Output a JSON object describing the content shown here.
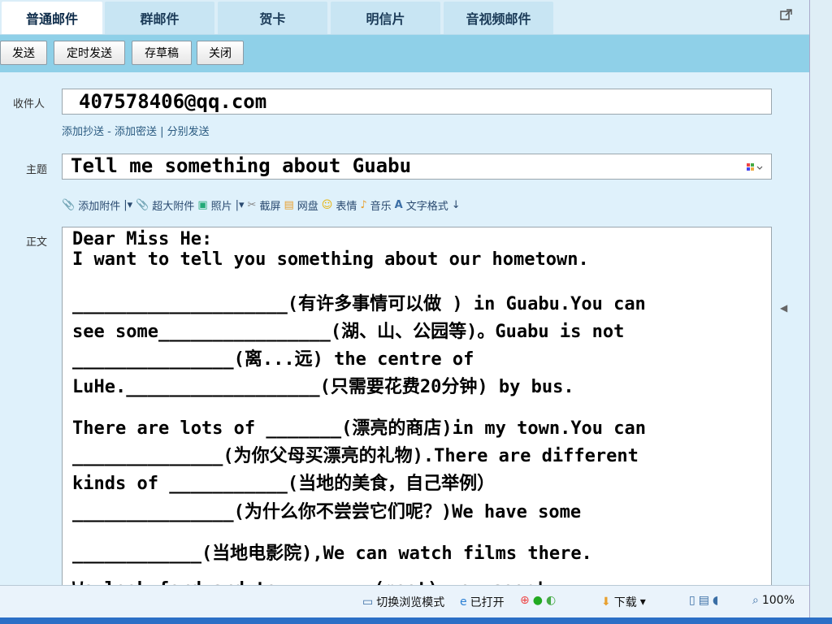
{
  "tabs": [
    {
      "label": "普通邮件",
      "active": true
    },
    {
      "label": "群邮件",
      "active": false
    },
    {
      "label": "贺卡",
      "active": false
    },
    {
      "label": "明信片",
      "active": false
    },
    {
      "label": "音视频邮件",
      "active": false
    }
  ],
  "toolbar": {
    "send": "发送",
    "scheduled_send": "定时发送",
    "save_draft": "存草稿",
    "close": "关闭"
  },
  "to": {
    "label": "收件人",
    "value": "407578406@qq.com"
  },
  "cc_links": "添加抄送 - 添加密送 | 分别发送",
  "subject": {
    "label": "主题",
    "value": "Tell me something about Guabu"
  },
  "attach_bar": {
    "attach": "添加附件",
    "big_attach": "超大附件",
    "photo": "照片",
    "screenshot": "截屏",
    "netdisk": "网盘",
    "emoji": "表情",
    "music": "音乐",
    "text_format": "文字格式"
  },
  "body": {
    "label": "正文",
    "lines": [
      "Dear Miss He:",
      "   I want to tell you something about our hometown.",
      "____________________(有许多事情可以做 ) in Guabu.You can",
      "see some________________(湖、山、公园等)。Guabu is not",
      "_______________(离...远) the centre of",
      "LuHe.__________________(只需要花费20分钟) by bus.",
      "There are lots of _______(漂亮的商店)in my town.You can",
      "______________(为你父母买漂亮的礼物).There are different",
      "kinds of ___________(当地的美食，自己举例）",
      "_______________(为什么你不尝尝它们呢？)We  have some",
      "____________(当地电影院),We can watch films there.",
      "We look fordward to ________(meet) you soon!"
    ]
  },
  "statusbar": {
    "switch_mode": "切换浏览模式",
    "open": "已打开",
    "download": "下载",
    "zoom": "100%"
  },
  "icons": [
    "popout-icon",
    "attach-icon",
    "big-attach-icon",
    "photo-icon",
    "screenshot-icon",
    "netdisk-icon",
    "emoji-icon",
    "music-icon",
    "text-format-icon",
    "palette-icon",
    "scroll-left-icon"
  ]
}
